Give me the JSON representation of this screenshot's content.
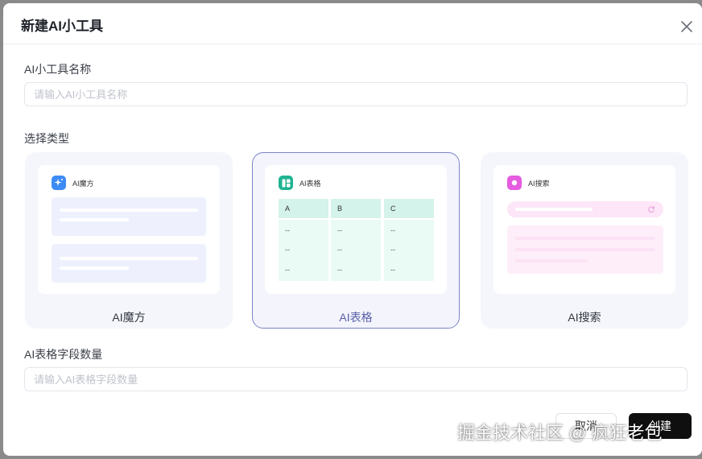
{
  "dialog": {
    "title": "新建AI小工具",
    "close_icon": "close-icon"
  },
  "name_field": {
    "label": "AI小工具名称",
    "placeholder": "请输入AI小工具名称",
    "value": ""
  },
  "type_section": {
    "label": "选择类型",
    "selected": "AI表格",
    "cards": [
      {
        "label": "AI魔方",
        "preview_title": "AI魔方",
        "icon": "sparkle-icon",
        "color": "#3d8bf5"
      },
      {
        "label": "AI表格",
        "preview_title": "AI表格",
        "icon": "table-icon",
        "color": "#20b391",
        "columns": [
          "A",
          "B",
          "C"
        ],
        "cell": "--"
      },
      {
        "label": "AI搜索",
        "preview_title": "AI搜索",
        "icon": "search-icon",
        "color": "#e55ce0"
      }
    ]
  },
  "field_count": {
    "label": "AI表格字段数量",
    "placeholder": "请输入AI表格字段数量",
    "value": ""
  },
  "footer": {
    "cancel_label": "取消",
    "create_label": "创建"
  },
  "watermark": "掘金技术社区 @ 疯狂老包"
}
